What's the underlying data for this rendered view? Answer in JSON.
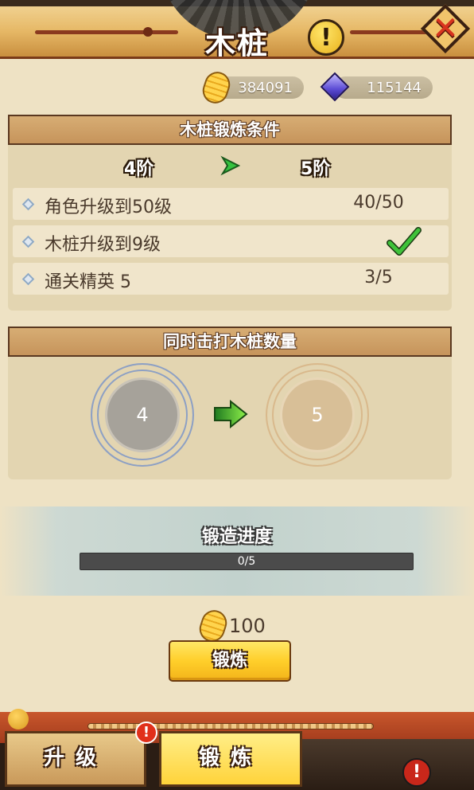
{
  "header": {
    "title": "木桩",
    "info_icon": "exclamation-info-icon",
    "close_icon": "crossed-swords-close-icon"
  },
  "currency": {
    "gold": "384091",
    "gem": "115144"
  },
  "conditions": {
    "title": "木桩锻炼条件",
    "from_stage": "4阶",
    "to_stage": "5阶",
    "rows": [
      {
        "label": "角色升级到50级",
        "progress": "40/50",
        "done": false
      },
      {
        "label": "木桩升级到9级",
        "progress": "",
        "done": true
      },
      {
        "label": "通关精英 5",
        "progress": "3/5",
        "done": false
      }
    ]
  },
  "targets": {
    "title": "同时击打木桩数量",
    "current": "4",
    "next": "5"
  },
  "forge_progress": {
    "title": "锻造进度",
    "text": "0/5",
    "fraction": 0
  },
  "cost": {
    "amount": "100"
  },
  "forge_button": "锻炼",
  "tabs": {
    "upgrade": "升级",
    "forge": "锻炼"
  },
  "colors": {
    "accent_gold": "#ffcf2a",
    "progress_fill": "#6fae3d",
    "check_green": "#3fc23a",
    "alert_red": "#e1301b"
  }
}
